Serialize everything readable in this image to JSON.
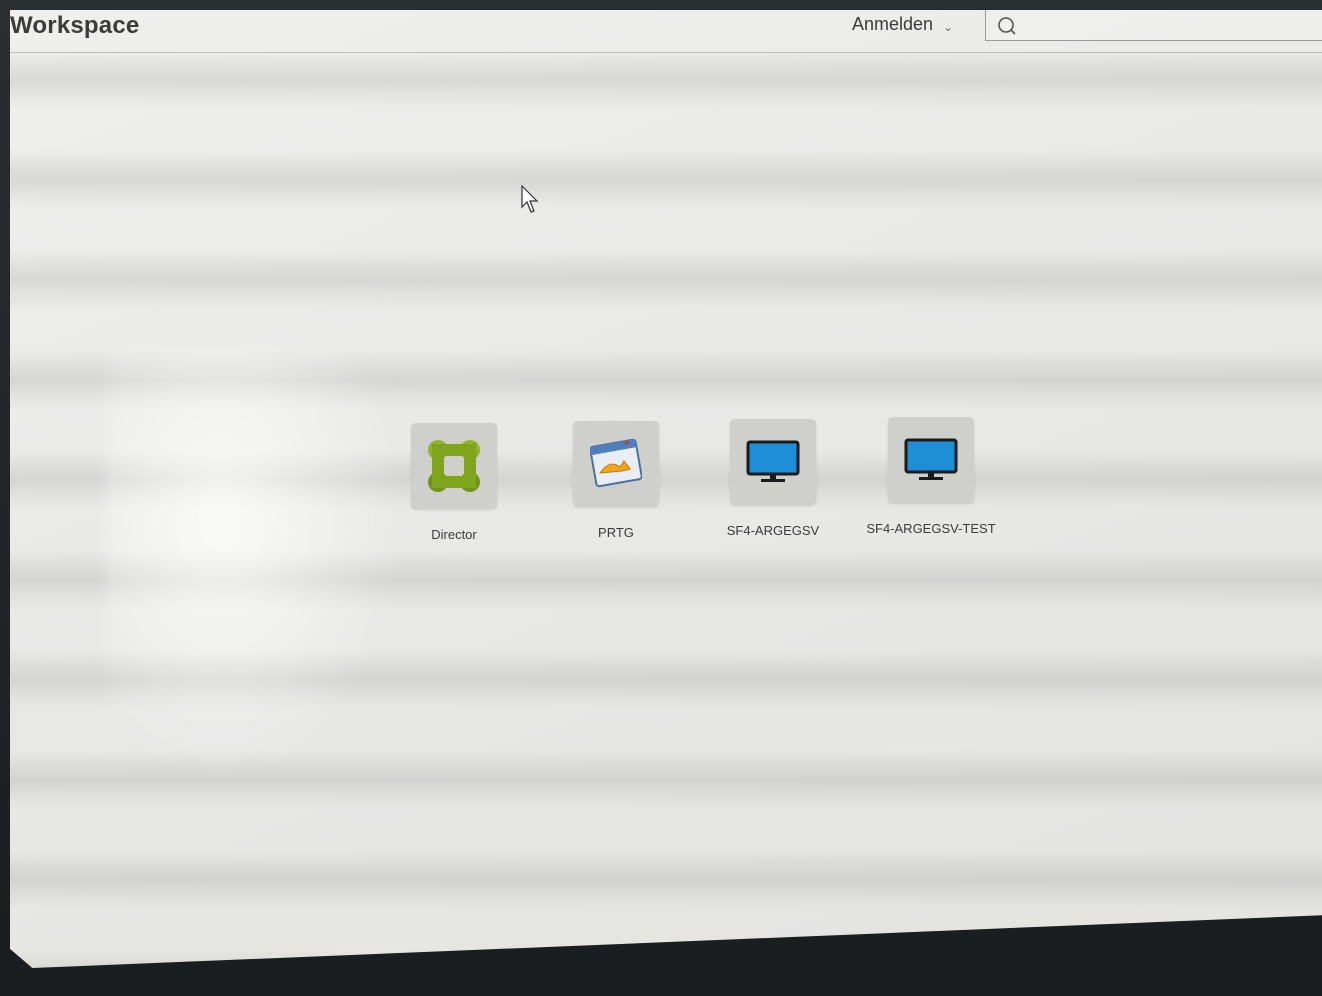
{
  "header": {
    "brand": "Workspace",
    "signin_label": "Anmelden",
    "search": {
      "placeholder": ""
    }
  },
  "apps": [
    {
      "label": "Director",
      "icon": "director-icon"
    },
    {
      "label": "PRTG",
      "icon": "prtg-icon"
    },
    {
      "label": "SF4-ARGEGSV",
      "icon": "monitor-icon"
    },
    {
      "label": "SF4-ARGEGSV-TEST",
      "icon": "monitor-icon"
    }
  ],
  "colors": {
    "page_background": "#ebebe8",
    "tile_background": "#cfcfcc",
    "monitor_blue": "#1e8fd6",
    "director_green": "#7fa51d"
  }
}
